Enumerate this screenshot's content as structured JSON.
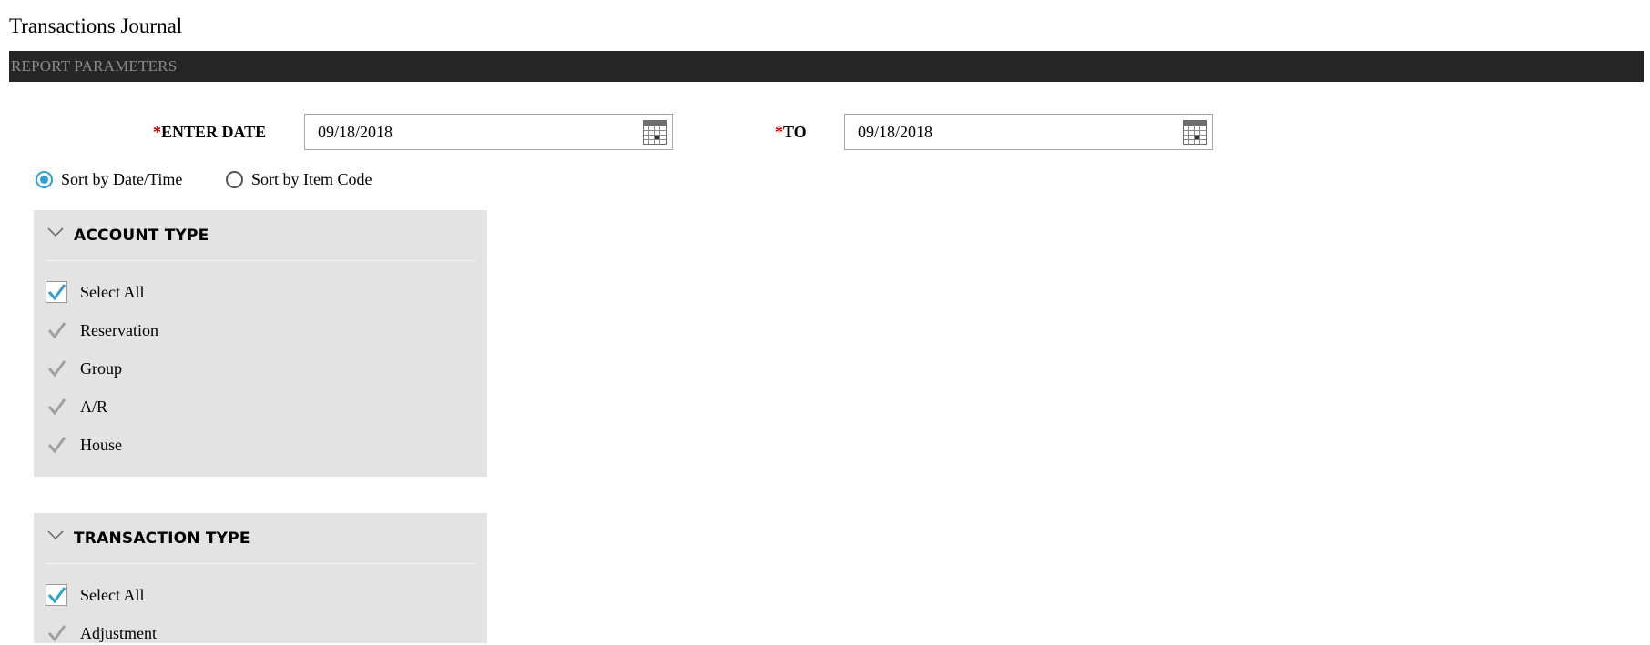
{
  "page": {
    "title": "Transactions Journal"
  },
  "section_bar": {
    "label": "REPORT PARAMETERS"
  },
  "date_range": {
    "required_mark": "*",
    "start_label": "ENTER DATE",
    "start_value": "09/18/2018",
    "end_label": "TO",
    "end_value": "09/18/2018",
    "icon": "calendar-icon"
  },
  "sort_options": [
    {
      "label": "Sort by Date/Time",
      "selected": true
    },
    {
      "label": "Sort by Item Code",
      "selected": false
    }
  ],
  "account_type": {
    "title": "ACCOUNT TYPE",
    "items": [
      {
        "label": "Select All",
        "checked": true,
        "style": "boxed"
      },
      {
        "label": "Reservation",
        "checked": true,
        "style": "plain"
      },
      {
        "label": "Group",
        "checked": true,
        "style": "plain"
      },
      {
        "label": "A/R",
        "checked": true,
        "style": "plain"
      },
      {
        "label": "House",
        "checked": true,
        "style": "plain"
      }
    ]
  },
  "transaction_type": {
    "title": "TRANSACTION TYPE",
    "items": [
      {
        "label": "Select All",
        "checked": true,
        "style": "boxed"
      },
      {
        "label": "Adjustment",
        "checked": true,
        "style": "plain"
      }
    ]
  },
  "colors": {
    "accent": "#2e9fd4",
    "header_bar": "#262626",
    "panel_bg": "#e3e3e3",
    "required": "#d00000",
    "disabled_check": "#a0a0a0"
  }
}
